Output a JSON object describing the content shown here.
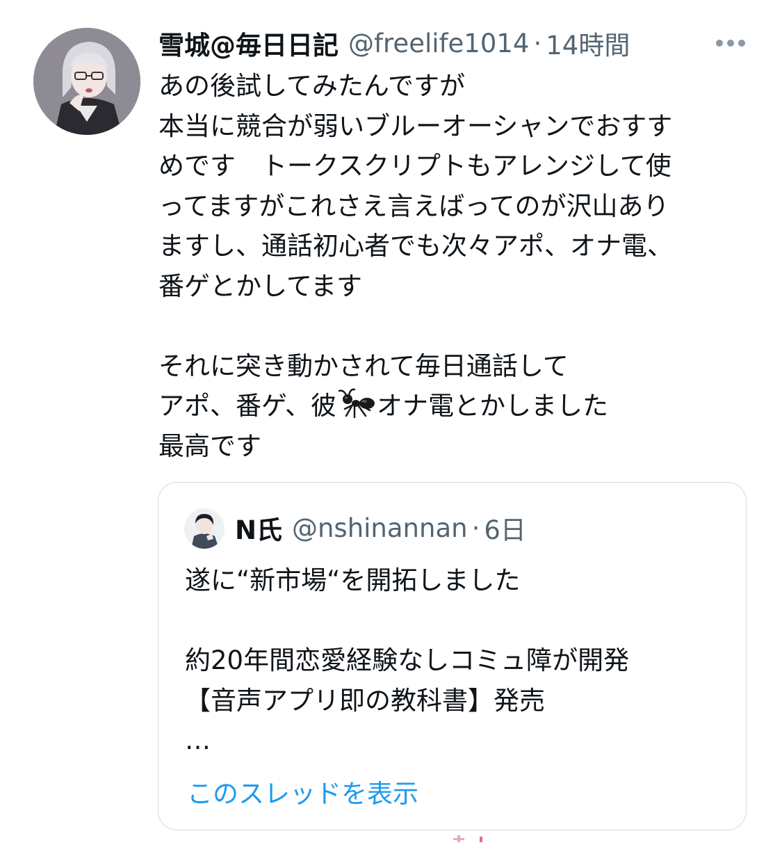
{
  "tweet": {
    "display_name": "雪城@毎日日記",
    "handle": "@freelife1014",
    "separator": "·",
    "time": "14時間",
    "avatar_icon": "user-avatar-anime-glasses",
    "more_icon": "more-horizontal-icon",
    "lines": [
      "あの後試してみたんですが",
      "本当に競合が弱いブルーオーシャンでおすす",
      "めです　トークスクリプトもアレンジして使",
      "ってますがこれさえ言えばってのが沢山あり",
      "ますし、通話初心者でも次々アポ、オナ電、",
      "番ゲとかしてます",
      "",
      "それに突き動かされて毎日通話して"
    ],
    "line_with_emoji": {
      "before": "アポ、番ゲ、彼",
      "emoji": "ant-emoji",
      "after": "オナ電とかしました"
    },
    "last_line": "最高です"
  },
  "quote": {
    "display_name": "N氏",
    "handle": "@nshinannan",
    "separator": "·",
    "time": "6日",
    "avatar_icon": "user-avatar-illustration",
    "lines": [
      "遂に“新市場“を開拓しました",
      "",
      "約20年間恋愛経験なしコミュ障が開発",
      "【音声アプリ即の教科書】発売",
      "…"
    ],
    "show_thread_link": "このスレッドを表示",
    "link_color": "#1d9bf0"
  }
}
